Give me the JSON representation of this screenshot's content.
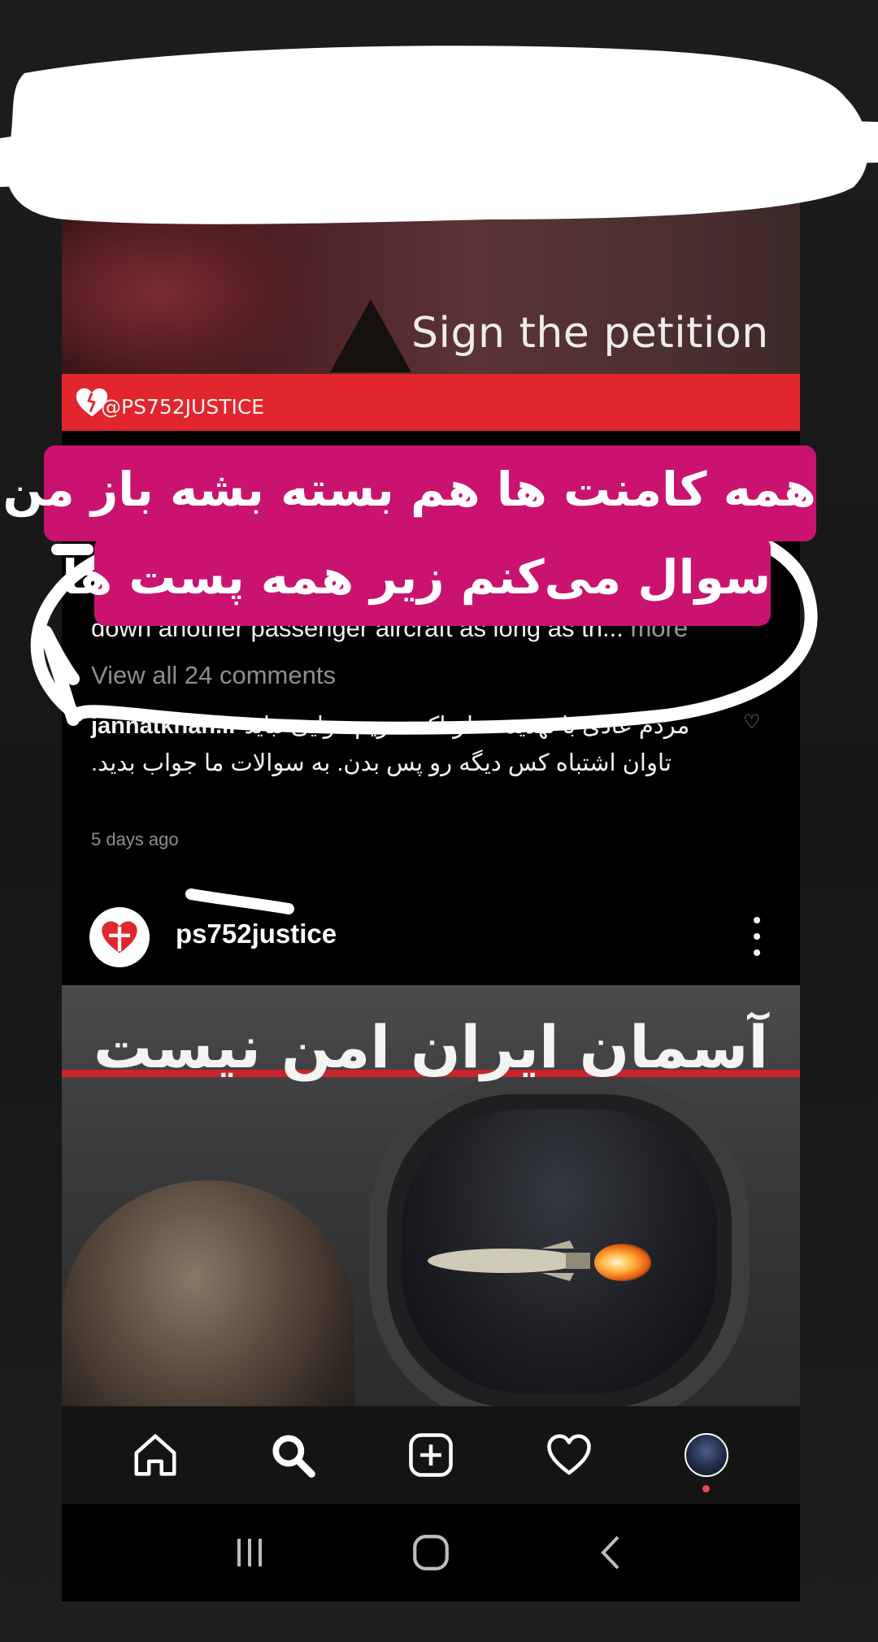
{
  "promo": {
    "text": "Sign the petition",
    "handle": "@PS752JUSTICE"
  },
  "post_caption": {
    "text": "down another passenger aircraft as long as th...",
    "more_label": "more"
  },
  "view_comments": "View all 24 comments",
  "comment": {
    "author": "jannatkhah.ir",
    "text": "مردم عادی با تهدید خطرناک تحریم هوایی نباید تاوان اشتباه کس دیگه رو پس بدن. به سوالات ما جواب بدید.",
    "time": "5 days ago"
  },
  "post": {
    "username": "ps752justice",
    "image_headline": "آسمان ایران امن نیست"
  },
  "sticker": {
    "line1": "همه کامنت ها هم بسته بشه باز من",
    "line2": "سوال می‌کنم زیر همه پست ها"
  },
  "bottom_nav": {
    "icons": [
      "home-icon",
      "search-icon",
      "add-post-icon",
      "heart-icon",
      "profile-avatar"
    ]
  },
  "system_nav": {
    "icons": [
      "recent-apps-icon",
      "home-circle-icon",
      "back-icon"
    ]
  },
  "colors": {
    "sticker_bg": "#c9136f",
    "brand_red": "#e1262d",
    "notification_dot": "#ed4956",
    "background": "#000000"
  }
}
